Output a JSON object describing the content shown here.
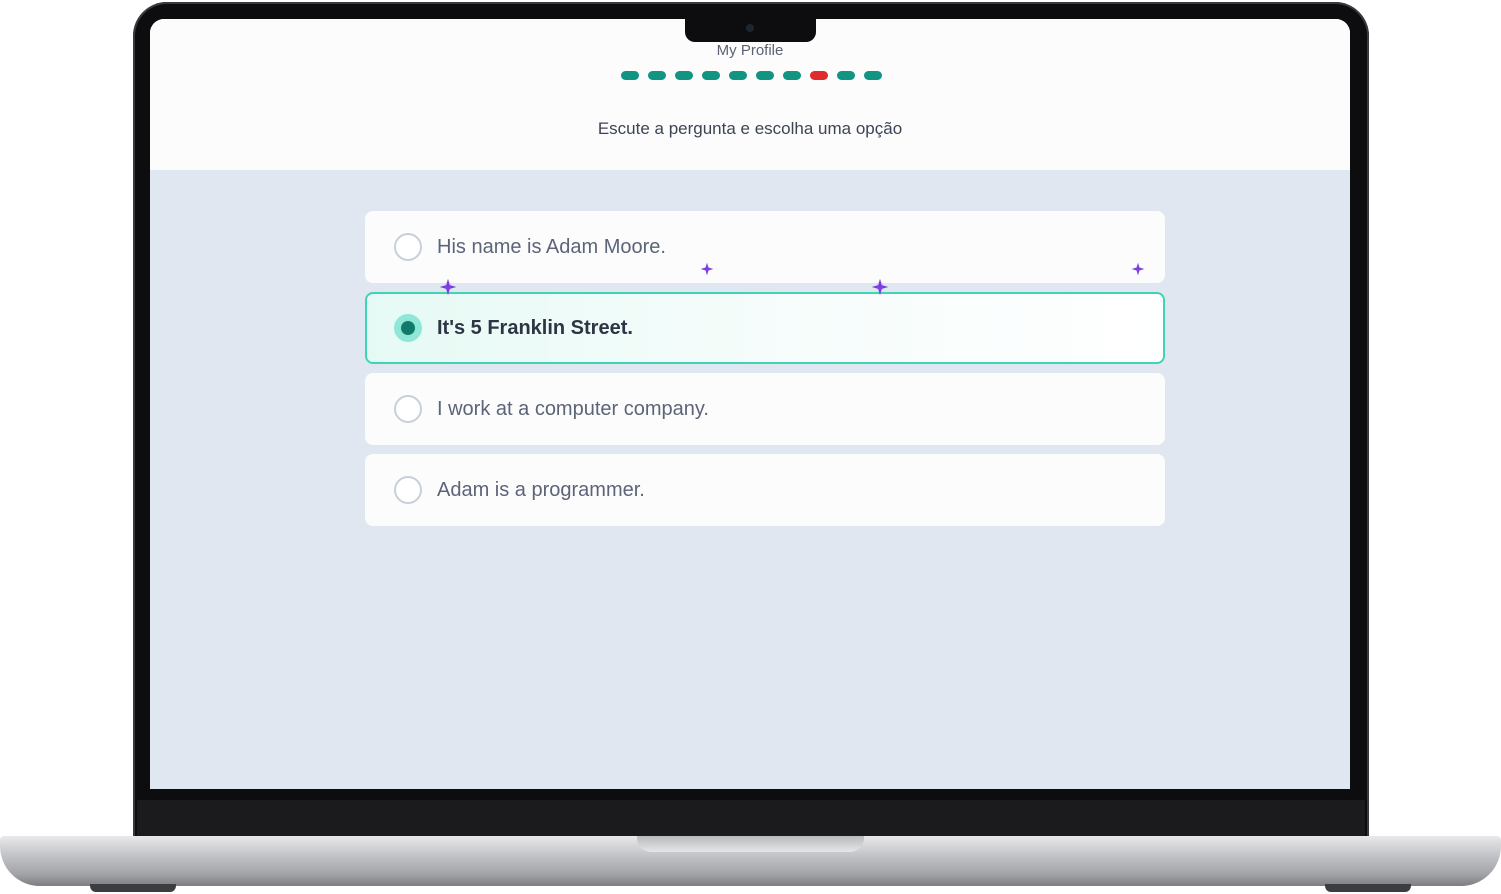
{
  "screen": {
    "title": "My Profile",
    "progress": {
      "total": 10,
      "current_index": 7,
      "dash_colors": [
        "#129483",
        "#129483",
        "#129483",
        "#129483",
        "#129483",
        "#129483",
        "#129483",
        "#e02b2b",
        "#129483",
        "#129483"
      ]
    },
    "instruction": "Escute a pergunta e escolha uma opção",
    "options": [
      {
        "label": "His name is Adam Moore.",
        "selected": false
      },
      {
        "label": "It's 5 Franklin Street.",
        "selected": true
      },
      {
        "label": "I work at a computer company.",
        "selected": false
      },
      {
        "label": "Adam is a programmer.",
        "selected": false
      }
    ]
  },
  "colors": {
    "accent": "#3ed4b5",
    "progress_done": "#129483",
    "progress_current": "#e02b2b",
    "sparkle": "#7b3fe4",
    "screen_background": "#e1e7f0"
  },
  "icons": {
    "sparkle": "sparkle-icon",
    "radio": "radio-icon"
  }
}
